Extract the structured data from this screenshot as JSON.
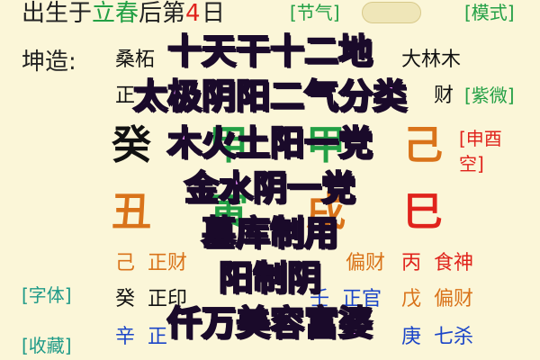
{
  "header": {
    "birth_prefix": "出生于",
    "solar_term": "立春",
    "after_text": "后第",
    "day_num": "4",
    "day_suffix": "日",
    "jieqi_tag": "[节气]",
    "mode_tag": "[模式]"
  },
  "kunzao": {
    "label": "坤造:",
    "nayin_1": "桑柘",
    "nayin_4": "大林木",
    "row2_left": "正",
    "row2_right": "财",
    "ziwei_tag": "[紫微]"
  },
  "stems": {
    "gui": "癸",
    "jia_mid": "甲",
    "jia2": "甲",
    "ji": "己",
    "shenyou_tag": "[申酉",
    "kong": "空]"
  },
  "branches": {
    "chou": "丑",
    "yin": "寅",
    "xu": "戌",
    "si": "巳"
  },
  "hidden_row1": {
    "ji": "己",
    "zhengcai": "正财",
    "piancai": "偏财",
    "bing": "丙",
    "shishen": "食神"
  },
  "hidden_row2": {
    "gui": "癸",
    "zhengyin": "正印",
    "ren": "壬",
    "zhengguan": "正官",
    "wu": "戊",
    "piancai": "偏财"
  },
  "hidden_row3": {
    "xin": "辛",
    "zheng": "正",
    "geng": "庚",
    "qisha": "七杀"
  },
  "side_tags": {
    "ziti": "[字体]",
    "shoucang": "[收藏]"
  },
  "overlay_lines": [
    "十天干十二地",
    "太极阴阳二气分类",
    "木火土阳一党",
    "金水阴一党",
    "墓库制用",
    "阳制阴",
    "仟万美容富婆"
  ],
  "colors": {
    "background": "#fbf6d8",
    "overlay_fill": "#ee90ff",
    "green": "#23a045",
    "red": "#e0231c",
    "orange": "#d9731a",
    "blue": "#1b45c8"
  }
}
